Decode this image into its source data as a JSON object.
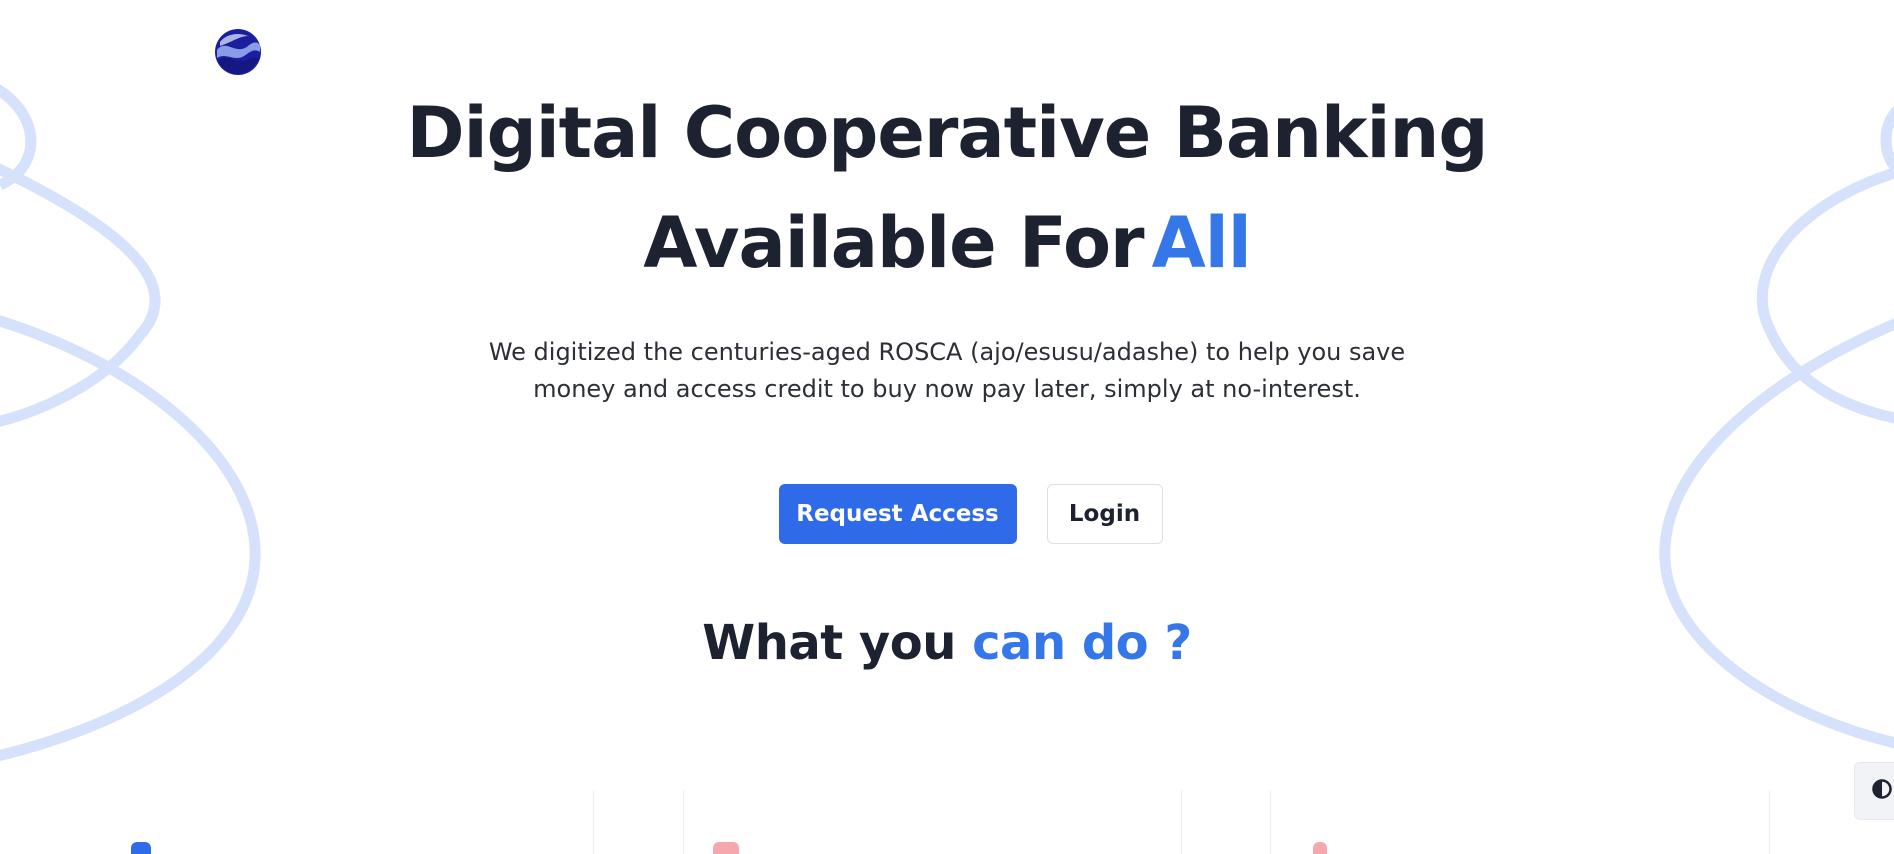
{
  "logo": {
    "icon": "globe-logo-icon"
  },
  "hero": {
    "title_line1": "Digital Cooperative Banking",
    "title_line2": "Available For",
    "title_accent": "All",
    "subtitle_line1": "We digitized the centuries-aged ROSCA (ajo/esusu/adashe) to help you save",
    "subtitle_line2": "money and access credit to buy now pay later, simply at no-interest."
  },
  "actions": {
    "request_access_label": "Request Access",
    "login_label": "Login"
  },
  "features": {
    "title": "What you",
    "title_accent": "can do ?"
  },
  "theme_toggle": {
    "icon": "contrast-icon"
  },
  "colors": {
    "accent": "#3577e8",
    "primary_button": "#2f6ae8",
    "heading": "#1c2230",
    "decor_lines": "#d6e2fb"
  }
}
